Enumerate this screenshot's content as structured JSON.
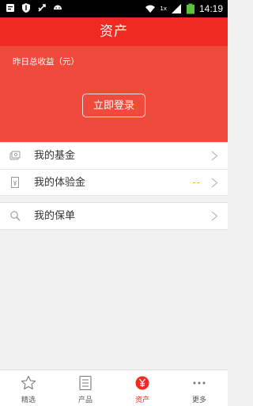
{
  "status_bar": {
    "time": "14:19",
    "network_label": "1x",
    "icons": [
      "notification-icon",
      "shield-icon",
      "usb-icon",
      "android-icon",
      "wifi-icon",
      "signal-icon",
      "battery-icon"
    ]
  },
  "app_bar": {
    "title": "资产"
  },
  "hero": {
    "yesterday_label": "昨日总收益（元）",
    "login_button": "立即登录",
    "colors": {
      "appbar": "#ee2a22",
      "hero": "#ef4a3c"
    }
  },
  "menu_group_1": {
    "items": [
      {
        "label": "我的基金",
        "icon": "fund-icon"
      },
      {
        "label": "我的体验金",
        "icon": "voucher-icon",
        "extra": "--"
      }
    ]
  },
  "menu_group_2": {
    "items": [
      {
        "label": "我的保单",
        "icon": "search-icon"
      }
    ]
  },
  "tabbar": {
    "tabs": [
      {
        "label": "精选",
        "icon": "star-icon",
        "active": false
      },
      {
        "label": "产品",
        "icon": "list-icon",
        "active": false
      },
      {
        "label": "资产",
        "icon": "yen-icon",
        "active": true
      },
      {
        "label": "更多",
        "icon": "more-icon",
        "active": false
      }
    ]
  }
}
